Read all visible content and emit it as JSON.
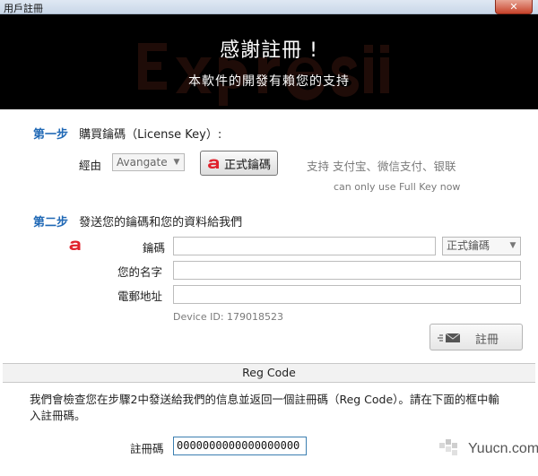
{
  "window": {
    "title": "用戶註冊",
    "close_glyph": "✕"
  },
  "banner": {
    "title": "感謝註冊 !",
    "subtitle": "本軟件的開發有賴您的支持"
  },
  "step1": {
    "number": "第一步",
    "text": "購買鑰碼（License Key）:",
    "via_label": "經由",
    "vendor_select": "Avangate",
    "official_button": "正式鑰碼",
    "support_text": "支持 支付宝、微信支付、银联",
    "note": "can only use Full Key now"
  },
  "step2": {
    "number": "第二步",
    "text": "發送您的鑰碼和您的資料給我們",
    "key_label": "鑰碼",
    "key_type_select": "正式鑰碼",
    "name_label": "您的名字",
    "email_label": "電郵地址",
    "device_id": "Device ID: 179018523",
    "register_button": "註冊",
    "key_value": "",
    "name_value": "",
    "email_value": ""
  },
  "regcode": {
    "section_label": "Reg Code",
    "description": "我們會檢查您在步驟2中發送給我們的信息並返回一個註冊碼（Reg Code）。請在下面的框中輸入註冊碼。",
    "label": "註冊碼",
    "value": "0000000000000000000"
  },
  "brand": {
    "site": "Yuucn.com"
  },
  "colors": {
    "step_blue": "#1f68b5",
    "avangate_red": "#e0222d",
    "banner_bg": "#000000"
  }
}
